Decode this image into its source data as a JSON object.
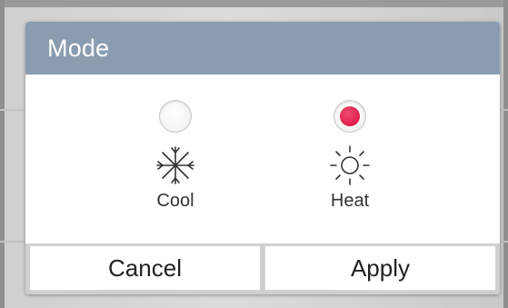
{
  "dialog": {
    "title": "Mode",
    "options": [
      {
        "label": "Cool",
        "icon": "snowflake-icon",
        "selected": false
      },
      {
        "label": "Heat",
        "icon": "sun-icon",
        "selected": true
      }
    ],
    "buttons": {
      "cancel_label": "Cancel",
      "apply_label": "Apply"
    }
  },
  "colors": {
    "header_background": "#8a9db0",
    "selected_radio": "#e01e4e",
    "dialog_background": "#ffffff"
  }
}
